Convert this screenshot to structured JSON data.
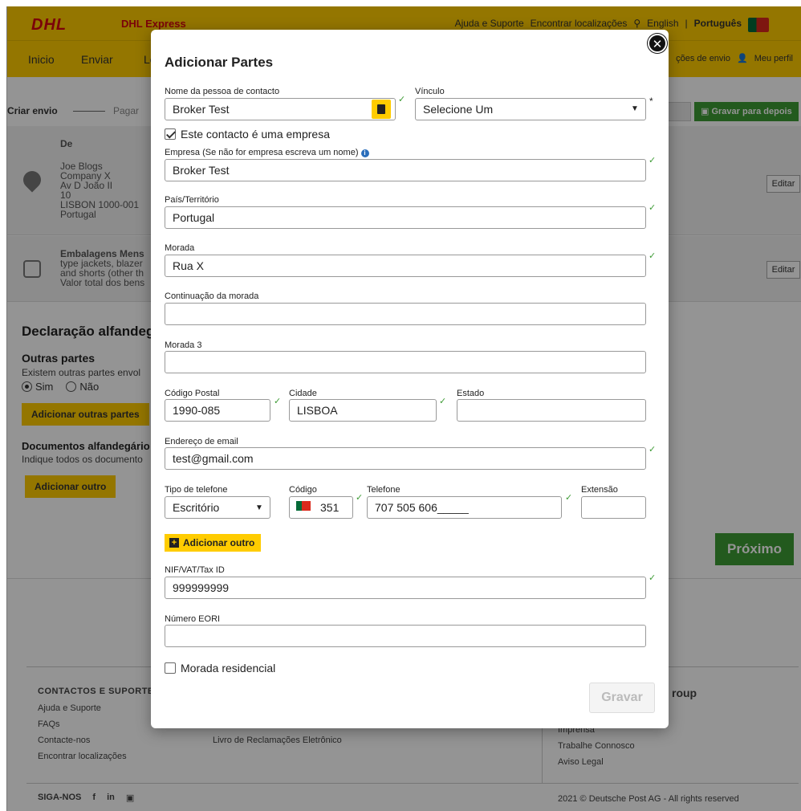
{
  "header": {
    "logo": "DHL",
    "logo_sub": "DHL Express",
    "links": [
      "Ajuda e Suporte",
      "Encontrar localizações"
    ],
    "lang_en": "English",
    "lang_pt": "Português"
  },
  "nav": {
    "items": [
      "Inicio",
      "Enviar",
      "Lo"
    ],
    "right_1": "ções de envio",
    "right_2": "Meu perfil"
  },
  "steps": {
    "current": "Criar envio",
    "next": "Pagar",
    "save_later": "Gravar para depois"
  },
  "sender": {
    "heading": "De",
    "lines": [
      "Joe Blogs",
      "Company X",
      "Av D João II",
      "10",
      "LISBON 1000-001",
      "Portugal"
    ],
    "edit": "Editar"
  },
  "package": {
    "lines": [
      "Embalagens Mens",
      "type jackets, blazer",
      "and shorts (other th",
      "Valor total dos bens"
    ],
    "edit": "Editar"
  },
  "customs": {
    "heading": "Declaração alfandeg",
    "other_parties_heading": "Outras partes",
    "other_parties_text": "Existem outras partes envol",
    "radio_yes": "Sim",
    "radio_no": "Não",
    "add_parties_btn": "Adicionar outras partes",
    "docs_heading": "Documentos alfandegário",
    "docs_text": "Indique todos os documento",
    "add_other_btn": "Adicionar outro",
    "next_btn": "Próximo"
  },
  "footer": {
    "contacts_heading": "CONTACTOS E SUPORTE",
    "contacts_links": [
      "Ajuda e Suporte",
      "FAQs",
      "Contacte-nos",
      "Encontrar localizações"
    ],
    "mid_link": "Livro de Reclamações Eletrônico",
    "group_heading": "roup",
    "group_links": [
      "Imprensa",
      "Trabalhe Connosco",
      "Aviso Legal"
    ],
    "follow": "SIGA-NOS",
    "social": [
      "f",
      "in"
    ],
    "copyright": "2021 © Deutsche Post AG - All rights reserved"
  },
  "modal": {
    "title": "Adicionar Partes",
    "close": "✕",
    "contact_name_label": "Nome da pessoa de contacto",
    "contact_name": "Broker Test",
    "link_label": "Vínculo",
    "link_value": "Selecione Um",
    "is_company_label": "Este contacto é uma empresa",
    "is_company": true,
    "company_label": "Empresa (Se não for empresa escreva um nome)",
    "company": "Broker Test",
    "country_label": "País/Território",
    "country": "Portugal",
    "address_label": "Morada",
    "address": "Rua X",
    "address2_label": "Continuação da morada",
    "address2": "",
    "address3_label": "Morada 3",
    "address3": "",
    "postal_label": "Código Postal",
    "postal": "1990-085",
    "city_label": "Cidade",
    "city": "LISBOA",
    "state_label": "Estado",
    "state": "",
    "email_label": "Endereço de email",
    "email": "test@gmail.com",
    "phone_type_label": "Tipo de telefone",
    "phone_type": "Escritório",
    "code_label": "Código",
    "code": "351",
    "phone_label": "Telefone",
    "phone": "707 505 606_____",
    "ext_label": "Extensão",
    "ext": "",
    "add_other": "Adicionar outro",
    "tax_label": "NIF/VAT/Tax ID",
    "tax": "999999999",
    "eori_label": "Número EORI",
    "eori": "",
    "residential_label": "Morada residencial",
    "residential": false,
    "save": "Gravar"
  },
  "colors": {
    "dhl_yellow": "#ffcc00",
    "dhl_red": "#d40511",
    "green": "#3d9b35"
  }
}
